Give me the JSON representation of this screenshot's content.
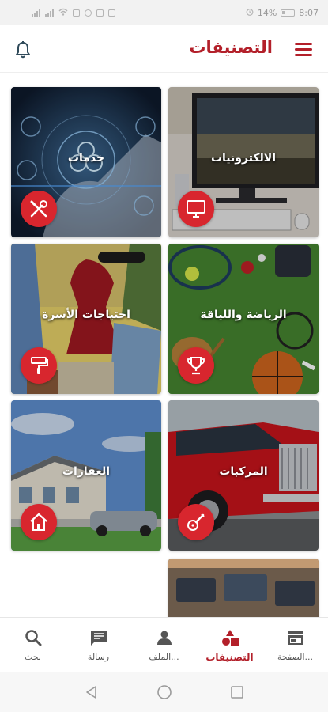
{
  "status_bar": {
    "battery_percent": "14%",
    "time": "8:07"
  },
  "header": {
    "title": "التصنيفات",
    "menu_icon": "hamburger-menu-icon",
    "notifications_icon": "bell-icon"
  },
  "categories": [
    {
      "label": "الالكترونيات",
      "icon": "monitor-icon"
    },
    {
      "label": "خدمات",
      "icon": "tools-icon"
    },
    {
      "label": "الرياضة واللياقة",
      "icon": "trophy-icon"
    },
    {
      "label": "احتياجات الأسرة",
      "icon": "paint-roller-icon"
    },
    {
      "label": "المركبات",
      "icon": "guitar-icon"
    },
    {
      "label": "العقارات",
      "icon": "house-icon"
    }
  ],
  "bottom_nav": [
    {
      "label": "الصفحة...",
      "icon": "store-icon",
      "active": false
    },
    {
      "label": "التصنيفات",
      "icon": "shapes-icon",
      "active": true
    },
    {
      "label": "الملف...",
      "icon": "person-icon",
      "active": false
    },
    {
      "label": "رسالة",
      "icon": "chat-icon",
      "active": false
    },
    {
      "label": "بحث",
      "icon": "search-icon",
      "active": false
    }
  ],
  "colors": {
    "brand_red": "#b3202a",
    "badge_red": "#d8262e"
  }
}
